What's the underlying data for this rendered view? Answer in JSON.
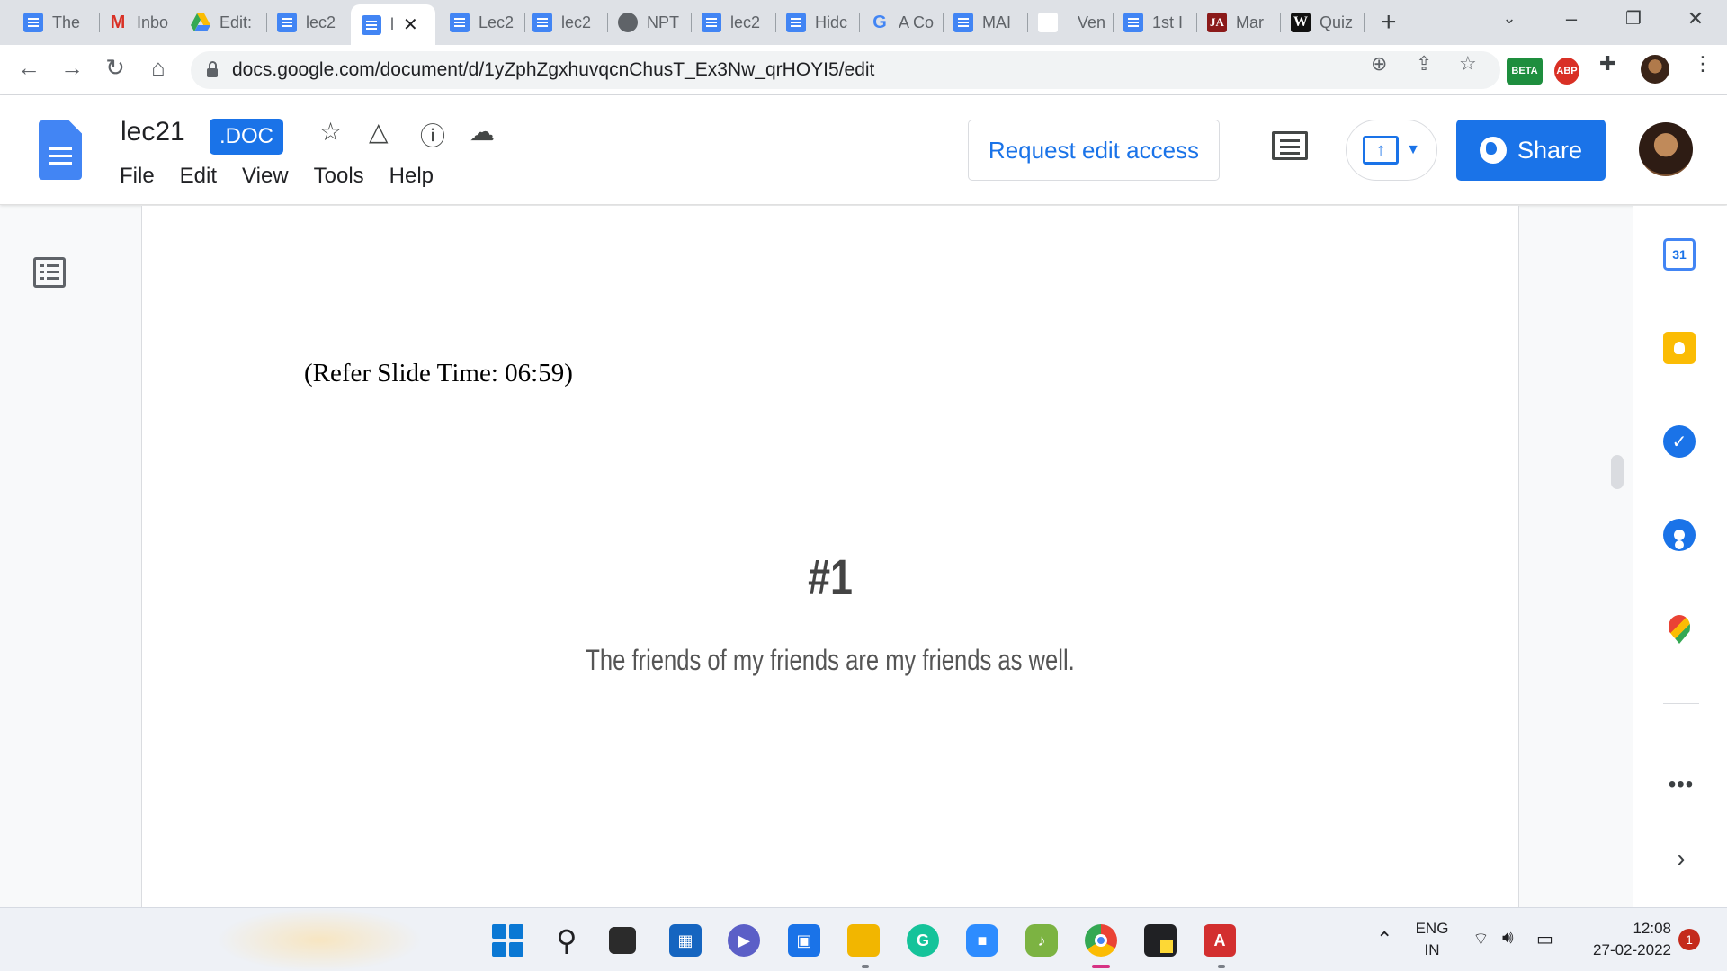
{
  "browser": {
    "tabs": [
      {
        "label": "The",
        "icon": "docs-icon"
      },
      {
        "label": "Inbo",
        "icon": "gmail-icon"
      },
      {
        "label": "Edit:",
        "icon": "drive-icon"
      },
      {
        "label": "lec2",
        "icon": "docs-icon"
      },
      {
        "label": "l",
        "icon": "docs-icon",
        "active": true
      },
      {
        "label": "Lec2",
        "icon": "docs-icon"
      },
      {
        "label": "lec2",
        "icon": "docs-icon"
      },
      {
        "label": "NPT",
        "icon": "globe-icon"
      },
      {
        "label": "lec2",
        "icon": "docs-icon"
      },
      {
        "label": "Hidc",
        "icon": "docs-icon"
      },
      {
        "label": "A Co",
        "icon": "google-icon"
      },
      {
        "label": "MAI",
        "icon": "docs-icon"
      },
      {
        "label": "Ven",
        "icon": "blank-icon"
      },
      {
        "label": "1st I",
        "icon": "docs-icon"
      },
      {
        "label": "Mar",
        "icon": "ja-icon"
      },
      {
        "label": "Quiz",
        "icon": "w-icon"
      }
    ],
    "url": "docs.google.com/document/d/1yZphZgxhuvqcnChusT_Ex3Nw_qrHOYI5/edit",
    "extension_beta": "BETA",
    "extension_abp": "ABP"
  },
  "docs": {
    "title": "lec21",
    "badge": ".DOC",
    "menu": [
      "File",
      "Edit",
      "View",
      "Tools",
      "Help"
    ],
    "request_edit_label": "Request edit access",
    "share_label": "Share",
    "accent_color": "#1a73e8"
  },
  "document": {
    "refer_line": "(Refer Slide Time: 06:59)",
    "slide_number": "#1",
    "slide_text": "The friends of my friends are my friends as well."
  },
  "sidepanel": {
    "calendar_day": "31",
    "more": "•••",
    "expand": "›"
  },
  "taskbar": {
    "language": "ENG",
    "region": "IN",
    "time": "12:08",
    "date": "27-02-2022",
    "notifications": "1"
  }
}
